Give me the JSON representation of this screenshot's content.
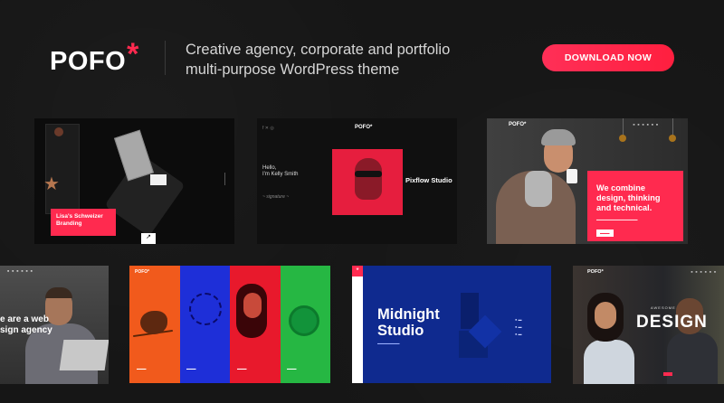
{
  "header": {
    "logo_text": "POFO",
    "logo_mark": "*",
    "tagline_line1": "Creative agency, corporate and portfolio",
    "tagline_line2": "multi-purpose WordPress theme",
    "download_label": "DOWNLOAD NOW"
  },
  "thumbs": {
    "t1": {
      "notebook_text": "SCHN\nAPP\nSIDEE",
      "card_title": "Lisa's Schweizer Branding"
    },
    "t2": {
      "logo": "POFO*",
      "hello": "Hello,",
      "hello_sub": "I'm Kelly Smith",
      "badge": "Pixflow Studio"
    },
    "t3": {
      "logo": "POFO*",
      "headline": "We combine design, thinking and technical."
    },
    "t4": {
      "headline_line1": "e are a web",
      "headline_line2": "sign agency"
    },
    "t5": {
      "logo": "POFO*"
    },
    "t6": {
      "title_line1": "Midnight",
      "title_line2": "Studio"
    },
    "t7": {
      "logo": "POFO*",
      "small": "AWESOME",
      "big": "DESIGN"
    }
  },
  "colors": {
    "accent": "#ff2a4f",
    "background": "#161616"
  }
}
